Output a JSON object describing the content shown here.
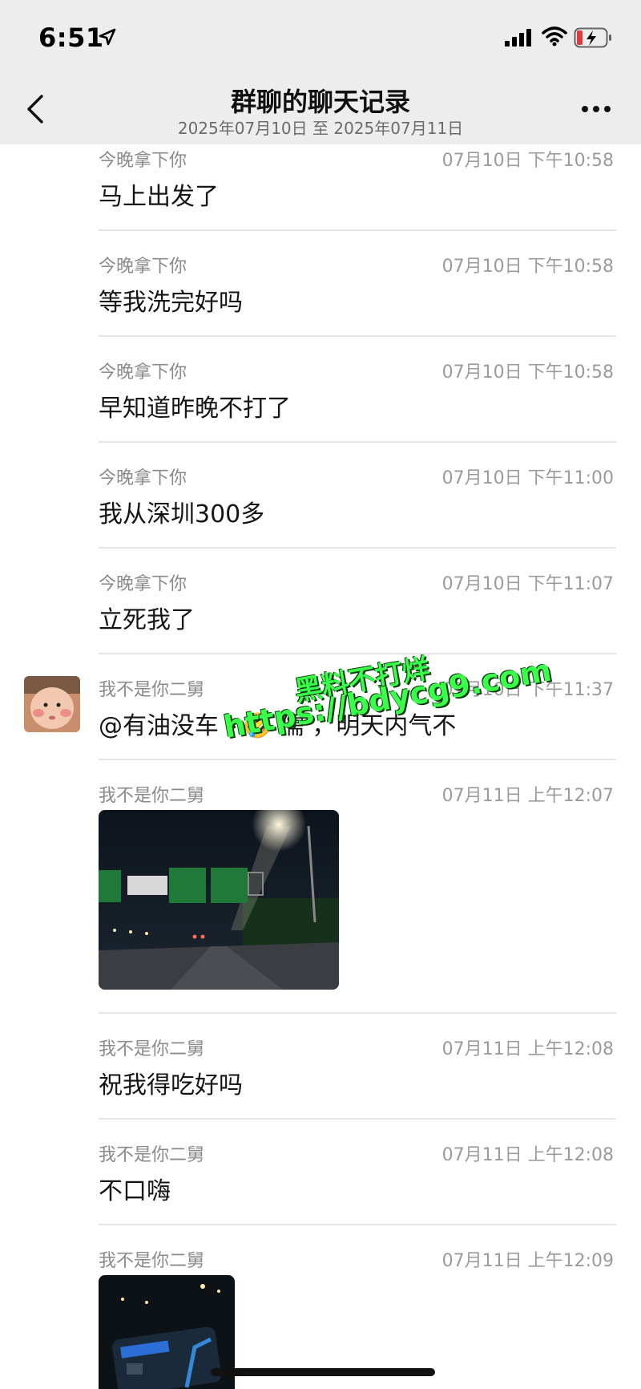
{
  "status_bar": {
    "time": "6:51"
  },
  "header": {
    "title": "群聊的聊天记录",
    "subtitle": "2025年07月10日 至 2025年07月11日"
  },
  "messages": [
    {
      "sender": "今晚拿下你",
      "time": "07月10日 下午10:58",
      "text": "马上出发了"
    },
    {
      "sender": "今晚拿下你",
      "time": "07月10日 下午10:58",
      "text": "等我洗完好吗"
    },
    {
      "sender": "今晚拿下你",
      "time": "07月10日 下午10:58",
      "text": "早知道昨晚不打了"
    },
    {
      "sender": "今晚拿下你",
      "time": "07月10日 下午11:00",
      "text": "我从深圳300多"
    },
    {
      "sender": "今晚拿下你",
      "time": "07月10日 下午11:07",
      "text": "立死我了"
    },
    {
      "sender": "我不是你二舅",
      "time": "07月10日 下午11:37",
      "text": "@有油没车丶🤣 儒 ，明天内气不"
    },
    {
      "sender": "我不是你二舅",
      "time": "07月11日 上午12:07",
      "text": ""
    },
    {
      "sender": "我不是你二舅",
      "time": "07月11日 上午12:08",
      "text": "祝我得吃好吗"
    },
    {
      "sender": "我不是你二舅",
      "time": "07月11日 上午12:08",
      "text": "不口嗨"
    },
    {
      "sender": "我不是你二舅",
      "time": "07月11日 上午12:09",
      "text": ""
    }
  ],
  "watermark": {
    "line1": "黑料不打烊",
    "line2": "https://bdycg9.com"
  },
  "colors": {
    "header_bg": "#ededed",
    "divider": "#e5e5e5",
    "watermark": "#39ff4a"
  },
  "icons": [
    "location-arrow-icon",
    "signal-icon",
    "wifi-icon",
    "battery-charging-icon",
    "back-chevron-icon",
    "more-dots-icon"
  ]
}
